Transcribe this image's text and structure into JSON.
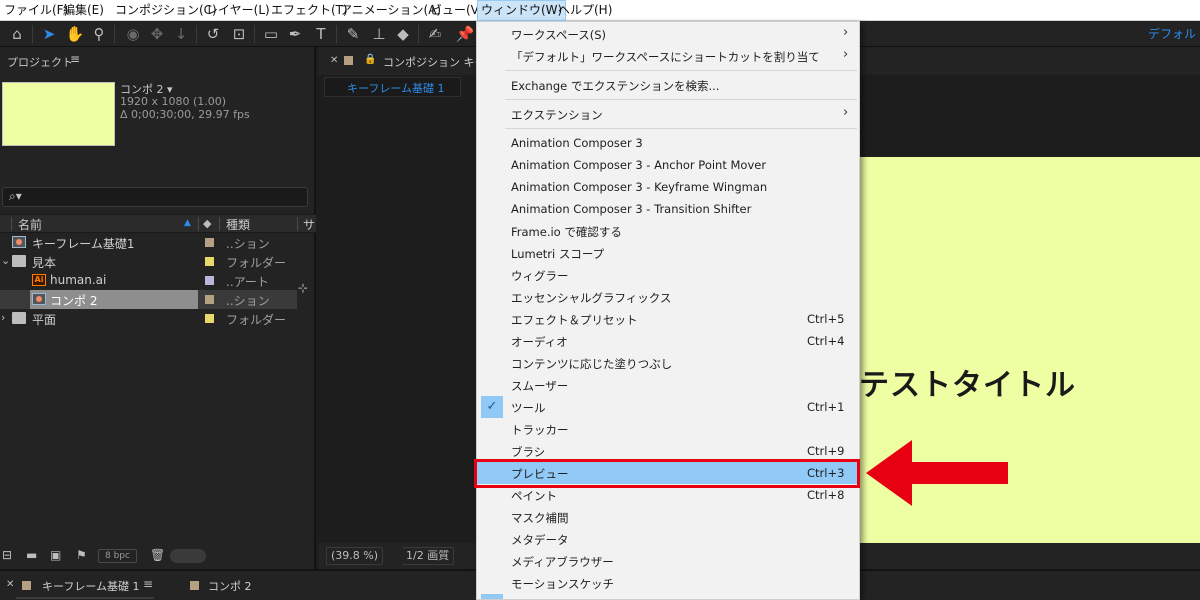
{
  "menubar": {
    "items": [
      "ファイル(F)",
      "編集(E)",
      "コンポジション(C)",
      "レイヤー(L)",
      "エフェクト(T)",
      "アニメーション(A)",
      "ビュー(V)",
      "ウィンドウ(W)",
      "ヘルプ(H)"
    ]
  },
  "toolbar": {
    "workspace": "デフォル"
  },
  "project": {
    "title": "プロジェクト",
    "menu_icon": "≡",
    "selected_name": "コンポ 2 ▾",
    "selected_resolution": "1920 x 1080 (1.00)",
    "selected_duration": "Δ 0;00;30;00, 29.97 fps",
    "search_icon": "⌕▾",
    "columns": {
      "name": "名前",
      "type": "種類",
      "extra": "サ"
    },
    "rows": [
      {
        "name": "キーフレーム基礎1",
        "type": "..ション",
        "color": "#b5a083",
        "icon": "composition-icon"
      },
      {
        "name": "見本",
        "type": "フォルダー",
        "color": "#e6d96a",
        "icon": "folder-icon"
      },
      {
        "name": "human.ai",
        "type": "..アート",
        "color": "#b7b7d8",
        "icon": "illustrator-file-icon"
      },
      {
        "name": "コンポ 2",
        "type": "..ション",
        "color": "#b5a083",
        "icon": "composition-icon"
      },
      {
        "name": "平面",
        "type": "フォルダー",
        "color": "#e6d96a",
        "icon": "folder-icon"
      }
    ],
    "bpc": "8 bpc"
  },
  "composition": {
    "tab_label": "コンポジション キーフ",
    "subtab_label": "キーフレーム基礎 1",
    "canvas_title": "テストタイトル",
    "zoom": "(39.8 %)",
    "resolution": "1/2 画質"
  },
  "timeline": {
    "tabs": [
      {
        "label": "キーフレーム基礎 1"
      },
      {
        "label": "コンポ 2"
      }
    ]
  },
  "window_menu": {
    "items": [
      {
        "label": "ワークスペース(S)",
        "submenu": true
      },
      {
        "label": "「デフォルト」ワークスペースにショートカットを割り当て",
        "submenu": true
      },
      {
        "label": "Exchange でエクステンションを検索..."
      },
      {
        "label": "エクステンション",
        "submenu": true
      },
      {
        "label": "Animation Composer 3"
      },
      {
        "label": "Animation Composer 3 - Anchor Point Mover"
      },
      {
        "label": "Animation Composer 3 - Keyframe Wingman"
      },
      {
        "label": "Animation Composer 3 - Transition Shifter"
      },
      {
        "label": "Frame.io で確認する"
      },
      {
        "label": "Lumetri スコープ"
      },
      {
        "label": "ウィグラー"
      },
      {
        "label": "エッセンシャルグラフィックス"
      },
      {
        "label": "エフェクト＆プリセット",
        "shortcut": "Ctrl+5"
      },
      {
        "label": "オーディオ",
        "shortcut": "Ctrl+4"
      },
      {
        "label": "コンテンツに応じた塗りつぶし"
      },
      {
        "label": "スムーザー"
      },
      {
        "label": "ツール",
        "shortcut": "Ctrl+1",
        "checked": true
      },
      {
        "label": "トラッカー"
      },
      {
        "label": "ブラシ",
        "shortcut": "Ctrl+9"
      },
      {
        "label": "プレビュー",
        "shortcut": "Ctrl+3",
        "highlighted": true
      },
      {
        "label": "ペイント",
        "shortcut": "Ctrl+8"
      },
      {
        "label": "マスク補間"
      },
      {
        "label": "メタデータ"
      },
      {
        "label": "メディアブラウザー"
      },
      {
        "label": "モーションスケッチ"
      }
    ],
    "check_mark": "✓",
    "submenu_arrow": "›"
  },
  "annotation": {
    "highlight_color": "#e60012"
  }
}
